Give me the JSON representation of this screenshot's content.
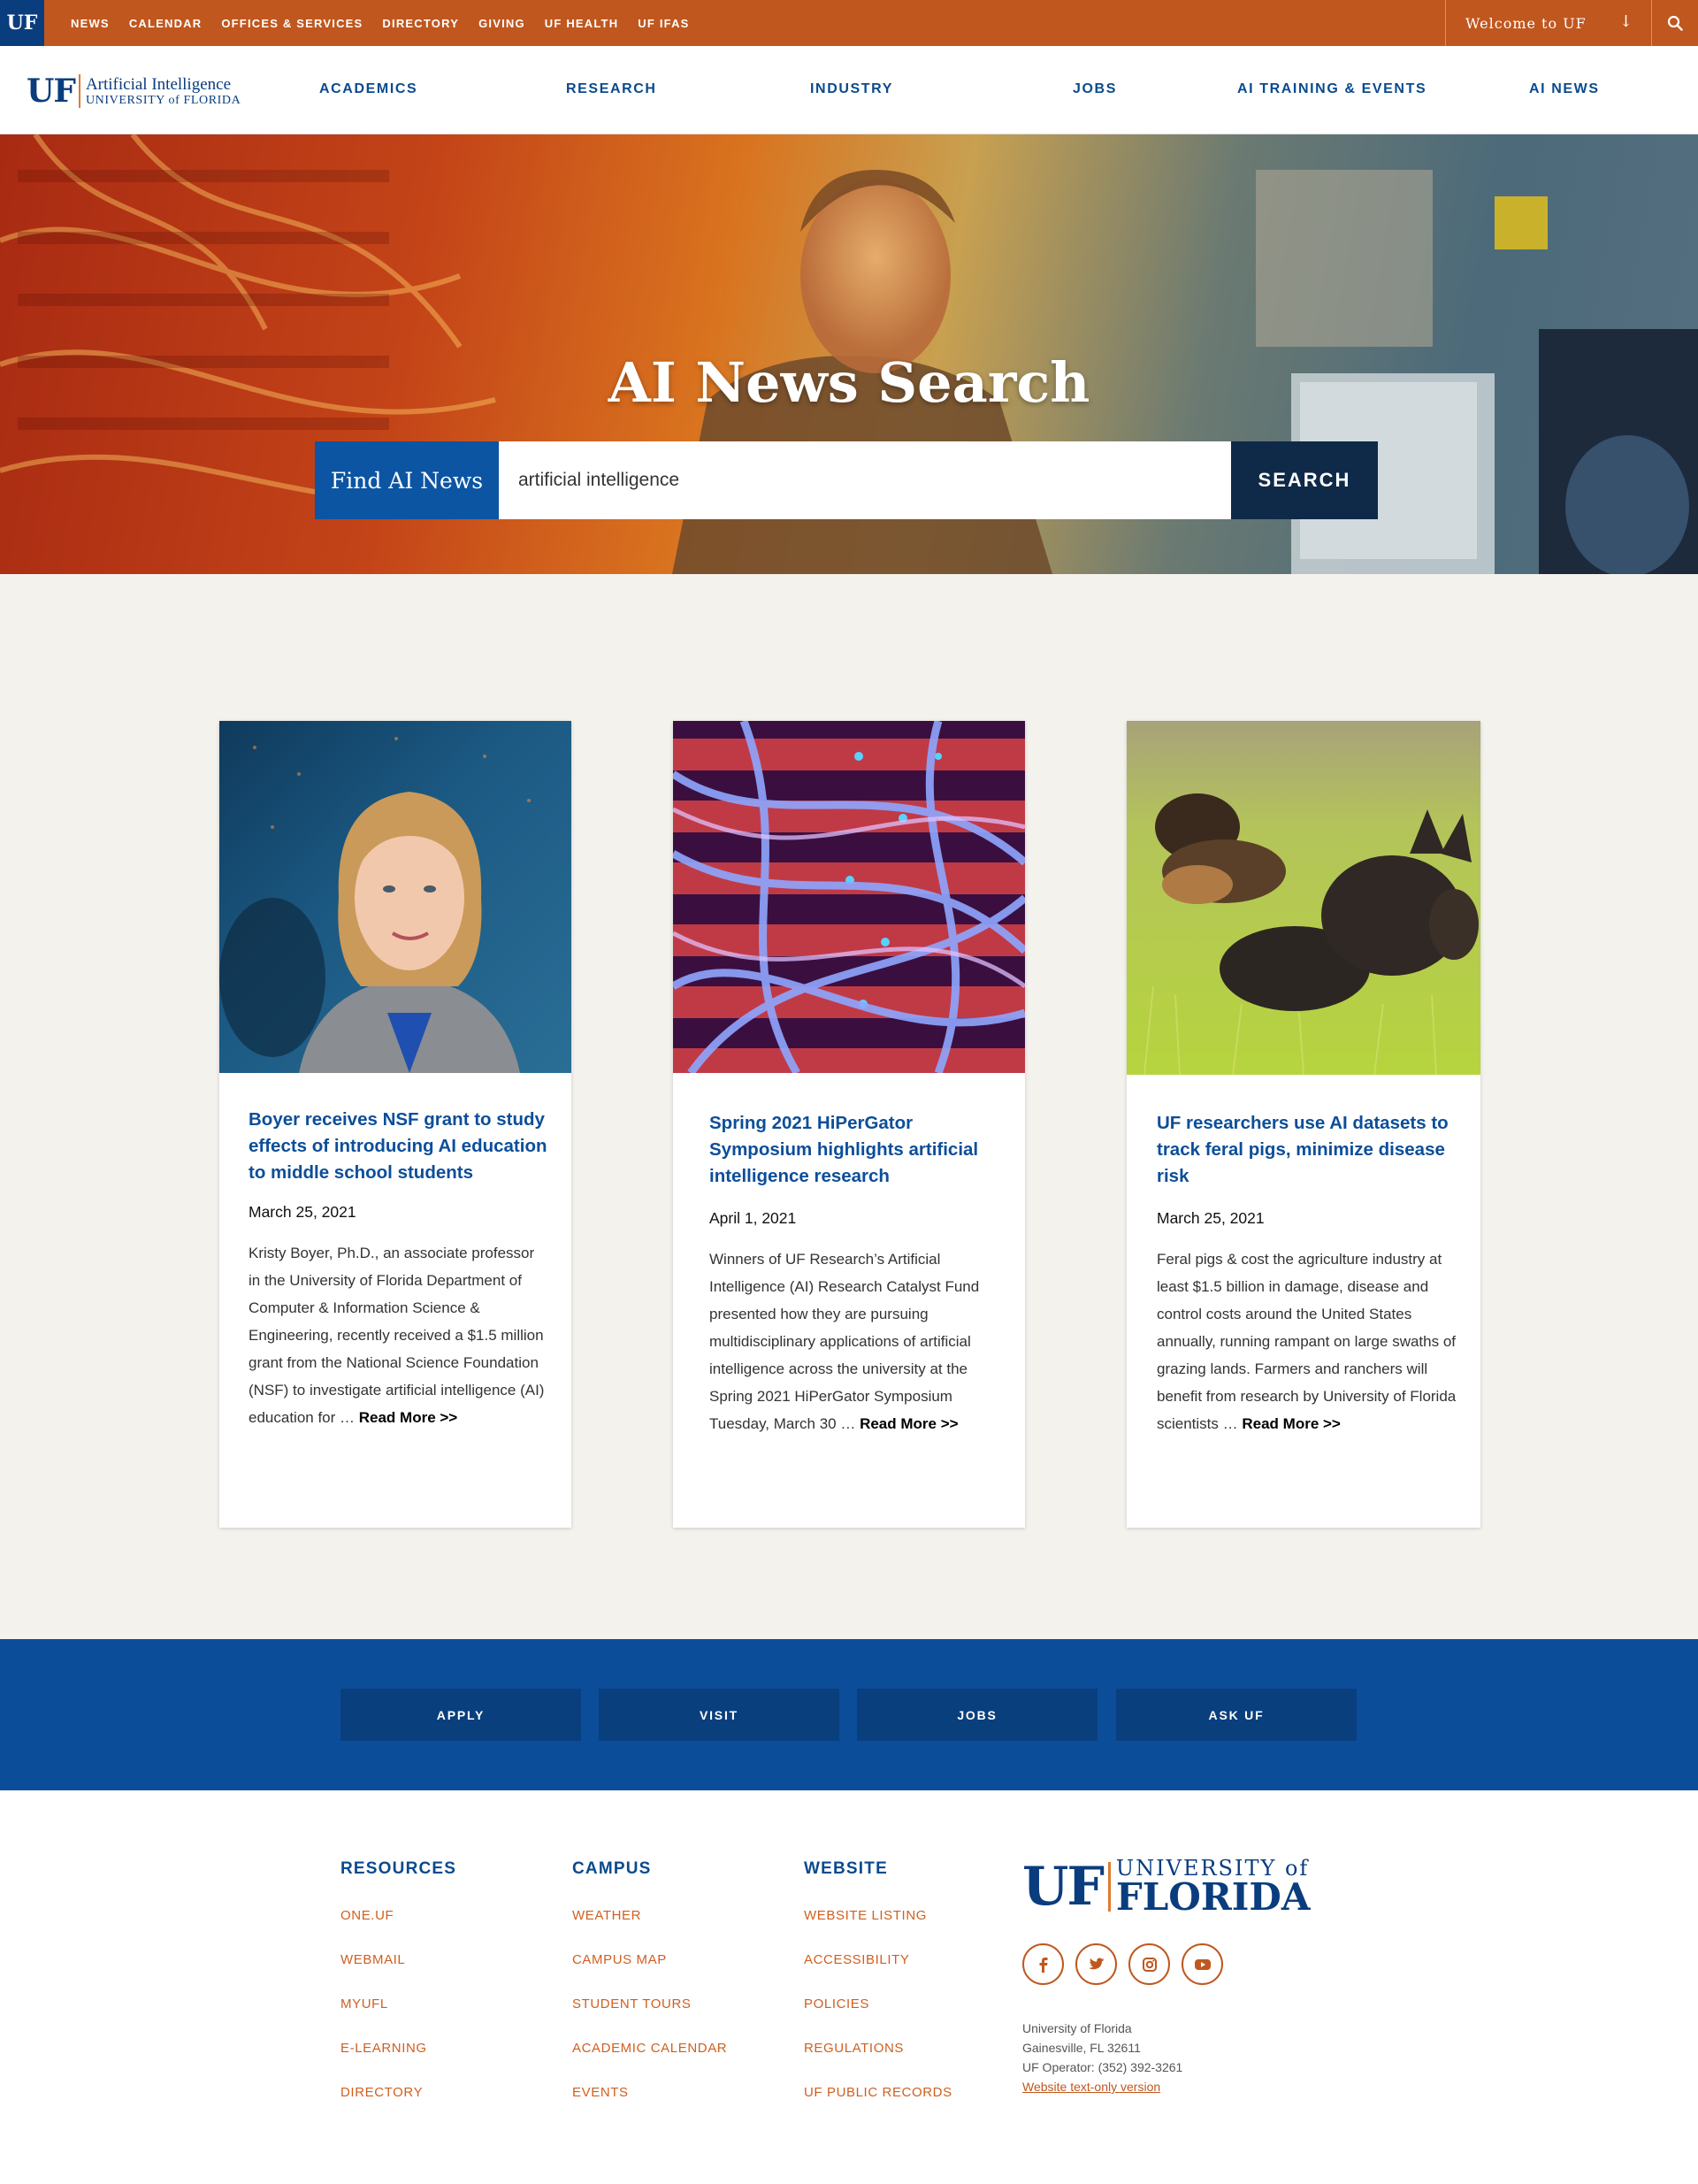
{
  "topbar": {
    "badge": "UF",
    "links": [
      "NEWS",
      "CALENDAR",
      "OFFICES & SERVICES",
      "DIRECTORY",
      "GIVING",
      "UF HEALTH",
      "UF IFAS"
    ],
    "welcome": "Welcome to UF"
  },
  "brand": {
    "uf": "UF",
    "line1": "Artificial Intelligence",
    "line2": "UNIVERSITY of FLORIDA"
  },
  "nav": {
    "items": [
      "ACADEMICS",
      "RESEARCH",
      "INDUSTRY",
      "JOBS",
      "AI TRAINING & EVENTS",
      "AI NEWS"
    ]
  },
  "hero": {
    "title": "AI News Search",
    "find_label": "Find AI News",
    "search_value": "artificial intelligence",
    "search_button": "SEARCH"
  },
  "cards": [
    {
      "title": "Boyer receives NSF grant to study effects of introducing AI education to middle school students",
      "date": "March  25, 2021",
      "excerpt": "Kristy Boyer, Ph.D., an associate professor in the University of Florida Department of Computer & Information Science & Engineering, recently received a $1.5 million grant from the National Science Foundation (NSF) to  investigate artificial intelligence (AI) education for … ",
      "more": "Read More >>"
    },
    {
      "title": "Spring 2021 HiPerGator Symposium highlights artificial intelligence research",
      "date": "April 1, 2021",
      "excerpt": "Winners of UF Research’s Artificial Intelligence (AI) Research Catalyst Fund presented how they are pursuing multidisciplinary applications of artificial intelligence across the university at the Spring 2021 HiPerGator Symposium Tuesday, March 30 … ",
      "more": "Read More >>"
    },
    {
      "title": "UF researchers use AI datasets to track feral pigs, minimize disease risk",
      "date": "March 25, 2021",
      "excerpt": "Feral pigs & cost the agriculture industry at least $1.5 billion in damage, disease and control costs around the United States annually, running rampant on large swaths of grazing lands. Farmers and ranchers will benefit from research by University of Florida scientists … ",
      "more": "Read More >>"
    }
  ],
  "cta": [
    "APPLY",
    "VISIT",
    "JOBS",
    "ASK UF"
  ],
  "footer": {
    "columns": [
      {
        "heading": "RESOURCES",
        "links": [
          "ONE.UF",
          "WEBMAIL",
          "MYUFL",
          "E-LEARNING",
          "DIRECTORY"
        ]
      },
      {
        "heading": "CAMPUS",
        "links": [
          "WEATHER",
          "CAMPUS MAP",
          "STUDENT TOURS",
          "ACADEMIC CALENDAR",
          "EVENTS"
        ]
      },
      {
        "heading": "WEBSITE",
        "links": [
          "WEBSITE LISTING",
          "ACCESSIBILITY",
          "POLICIES",
          "REGULATIONS",
          "UF PUBLIC RECORDS"
        ]
      }
    ],
    "logo": {
      "uf": "UF",
      "line1": "UNIVERSITY of",
      "line2": "FLORIDA"
    },
    "socials": [
      "facebook-icon",
      "twitter-icon",
      "instagram-icon",
      "youtube-icon"
    ],
    "address": [
      "University of Florida",
      "Gainesville, FL 32611",
      "UF Operator: (352) 392-3261"
    ],
    "text_only": "Website text-only version"
  },
  "colors": {
    "orange": "#c0571f",
    "navy": "#0a3d7e",
    "blue": "#0b4d98"
  }
}
